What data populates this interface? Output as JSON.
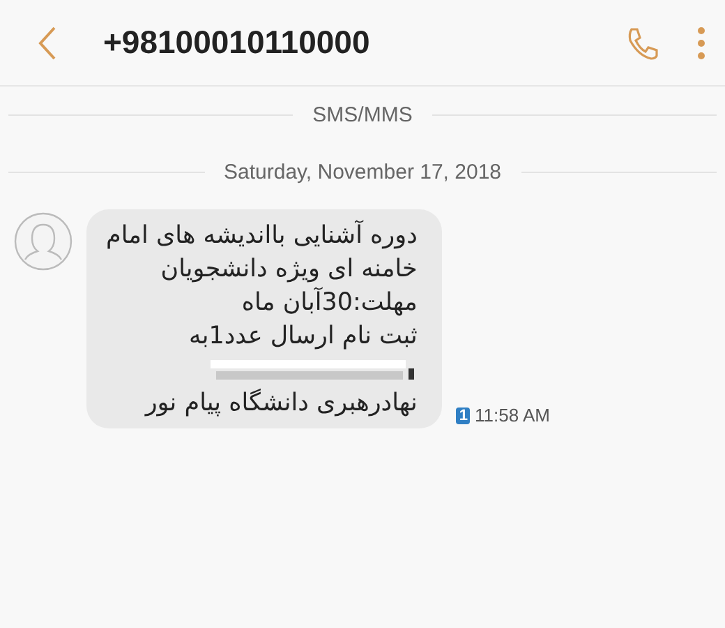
{
  "header": {
    "title": "+98100010110000"
  },
  "dividers": [
    "SMS/MMS",
    "Saturday, November 17, 2018"
  ],
  "message": {
    "lines": [
      {
        "kind": "text",
        "text": "دوره آشنایی بااندیشه های امام"
      },
      {
        "kind": "text",
        "text": "خامنه ای ویژه دانشجویان"
      },
      {
        "kind": "text",
        "text": "مهلت:30آبان ماه"
      },
      {
        "kind": "text",
        "text": "ثبت نام ارسال عدد1به"
      },
      {
        "kind": "redacted"
      },
      {
        "kind": "text",
        "text": "نهادرهبری دانشگاه پیام نور"
      }
    ],
    "sim": "1",
    "time": "11:58 AM"
  }
}
